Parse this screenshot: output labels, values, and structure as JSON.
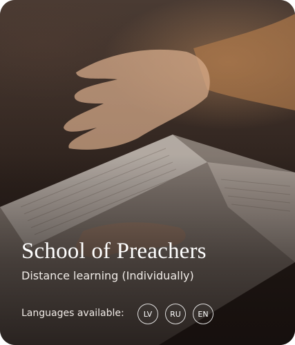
{
  "card": {
    "title": "School of Preachers",
    "subtitle": "Distance learning (Individually)",
    "languages_label": "Languages available:",
    "languages": [
      "LV",
      "RU",
      "EN"
    ]
  },
  "colors": {
    "text": "#ffffff",
    "background_dark": "#1f1714",
    "background_warm": "#be8c5f"
  }
}
